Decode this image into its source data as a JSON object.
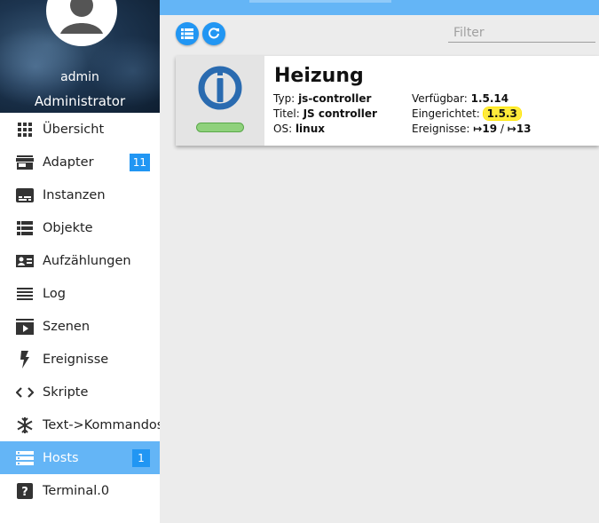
{
  "profile": {
    "name": "admin",
    "role": "Administrator"
  },
  "nav": [
    {
      "id": "uebersicht",
      "label": "Übersicht",
      "icon": "grid-icon"
    },
    {
      "id": "adapter",
      "label": "Adapter",
      "icon": "store-icon",
      "badge": "11"
    },
    {
      "id": "instanzen",
      "label": "Instanzen",
      "icon": "subtitles-icon"
    },
    {
      "id": "objekte",
      "label": "Objekte",
      "icon": "list-icon"
    },
    {
      "id": "aufzaehlungen",
      "label": "Aufzählungen",
      "icon": "contact-card-icon"
    },
    {
      "id": "log",
      "label": "Log",
      "icon": "lines-icon"
    },
    {
      "id": "szenen",
      "label": "Szenen",
      "icon": "slideshow-icon"
    },
    {
      "id": "ereignisse",
      "label": "Ereignisse",
      "icon": "lightning-icon"
    },
    {
      "id": "skripte",
      "label": "Skripte",
      "icon": "code-icon"
    },
    {
      "id": "text-kommandos",
      "label": "Text->Kommandos",
      "icon": "snowflake-icon"
    },
    {
      "id": "hosts",
      "label": "Hosts",
      "icon": "storage-icon",
      "badge": "1",
      "active": true
    },
    {
      "id": "terminal",
      "label": "Terminal.0",
      "icon": "help-box-icon"
    }
  ],
  "toolbar": {
    "filter_placeholder": "Filter",
    "filter_value": ""
  },
  "host": {
    "title": "Heizung",
    "typ_label": "Typ:",
    "typ_value": "js-controller",
    "titel_label": "Titel:",
    "titel_value": "JS controller",
    "os_label": "OS:",
    "os_value": "linux",
    "verfuegbar_label": "Verfügbar:",
    "verfuegbar_value": "1.5.14",
    "eingerichtet_label": "Eingerichtet:",
    "eingerichtet_value": "1.5.3",
    "ereignisse_label": "Ereignisse:",
    "ereignisse_in": "↦19",
    "ereignisse_sep": "/",
    "ereignisse_out": "↦13"
  },
  "colors": {
    "accent": "#2196f3",
    "active_nav": "#64b5f6",
    "status_ok": "#8fd17c",
    "highlight": "#ffeb3b",
    "logo": "#2a6bb0"
  }
}
